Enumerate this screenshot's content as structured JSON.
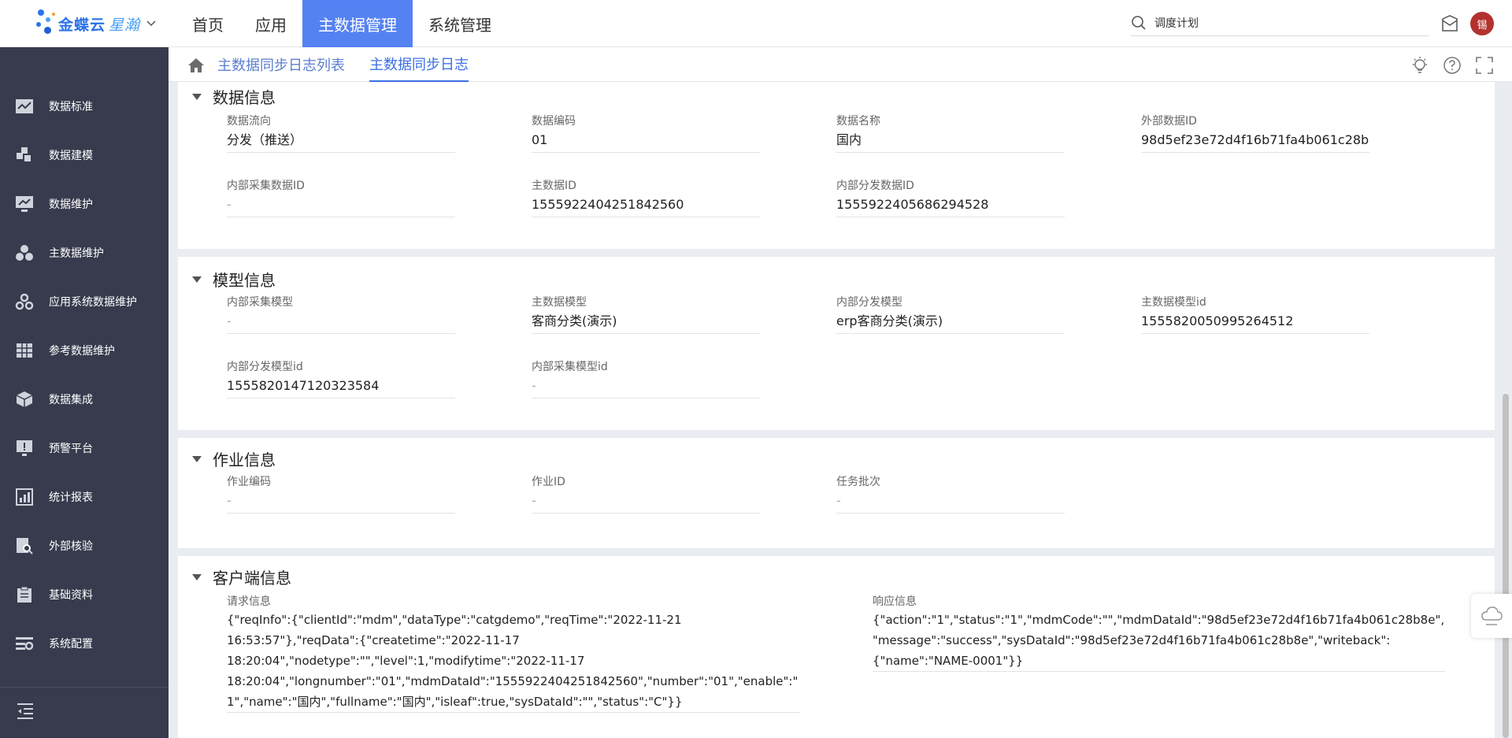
{
  "header": {
    "logo_text": "金蝶云",
    "logo_sub": "星瀚",
    "nav": [
      {
        "label": "首页"
      },
      {
        "label": "应用"
      },
      {
        "label": "主数据管理",
        "active": true
      },
      {
        "label": "系统管理"
      }
    ],
    "search_text": "调度计划",
    "avatar_text": "锡"
  },
  "sidebar": {
    "items": [
      {
        "label": "数据标准",
        "icon": "chart-board-icon"
      },
      {
        "label": "数据建模",
        "icon": "puzzle-icon"
      },
      {
        "label": "数据维护",
        "icon": "monitor-icon"
      },
      {
        "label": "主数据维护",
        "icon": "circles-icon"
      },
      {
        "label": "应用系统数据维护",
        "icon": "gears-icon"
      },
      {
        "label": "参考数据维护",
        "icon": "table-icon"
      },
      {
        "label": "数据集成",
        "icon": "cube-icon"
      },
      {
        "label": "预警平台",
        "icon": "alert-screen-icon"
      },
      {
        "label": "统计报表",
        "icon": "report-icon"
      },
      {
        "label": "外部核验",
        "icon": "search-doc-icon"
      },
      {
        "label": "基础资料",
        "icon": "clipboard-icon"
      },
      {
        "label": "系统配置",
        "icon": "settings-icon"
      }
    ]
  },
  "breadcrumb": {
    "items": [
      "主数据同步日志列表",
      "主数据同步日志"
    ]
  },
  "sections": {
    "data_info": {
      "title": "数据信息",
      "fields": [
        {
          "label": "数据流向",
          "value": "分发（推送）"
        },
        {
          "label": "数据编码",
          "value": "01"
        },
        {
          "label": "数据名称",
          "value": "国内"
        },
        {
          "label": "外部数据ID",
          "value": "98d5ef23e72d4f16b71fa4b061c28b8e"
        },
        {
          "label": "内部采集数据ID",
          "value": "-"
        },
        {
          "label": "主数据ID",
          "value": "1555922404251842560"
        },
        {
          "label": "内部分发数据ID",
          "value": "1555922405686294528"
        }
      ]
    },
    "model_info": {
      "title": "模型信息",
      "fields": [
        {
          "label": "内部采集模型",
          "value": "-"
        },
        {
          "label": "主数据模型",
          "value": "客商分类(演示)"
        },
        {
          "label": "内部分发模型",
          "value": "erp客商分类(演示)"
        },
        {
          "label": "主数据模型id",
          "value": "1555820050995264512"
        },
        {
          "label": "内部分发模型id",
          "value": "1555820147120323584"
        },
        {
          "label": "内部采集模型id",
          "value": "-"
        }
      ]
    },
    "job_info": {
      "title": "作业信息",
      "fields": [
        {
          "label": "作业编码",
          "value": "-"
        },
        {
          "label": "作业ID",
          "value": "-"
        },
        {
          "label": "任务批次",
          "value": "-"
        }
      ]
    },
    "client_info": {
      "title": "客户端信息",
      "request_label": "请求信息",
      "request_lines": [
        "{\"reqInfo\":{\"clientId\":\"mdm\",\"dataType\":\"catgdemo\",\"reqTime\":\"2022-11-21",
        "16:53:57\"},\"reqData\":{\"createtime\":\"2022-11-17",
        "18:20:04\",\"nodetype\":\"\",\"level\":1,\"modifytime\":\"2022-11-17",
        "18:20:04\",\"longnumber\":\"01\",\"mdmDataId\":\"1555922404251842560\",\"number\":\"01\",\"enable\":\"",
        "1\",\"name\":\"国内\",\"fullname\":\"国内\",\"isleaf\":true,\"sysDataId\":\"\",\"status\":\"C\"}}"
      ],
      "response_label": "响应信息",
      "response_lines": [
        "{\"action\":\"1\",\"status\":\"1\",\"mdmCode\":\"\",\"mdmDataId\":\"98d5ef23e72d4f16b71fa4b061c28b8e\",",
        "\"message\":\"success\",\"sysDataId\":\"98d5ef23e72d4f16b71fa4b061c28b8e\",\"writeback\":",
        "{\"name\":\"NAME-0001\"}}"
      ]
    }
  },
  "colors": {
    "accent": "#5582f3",
    "sidebar_bg": "#373b4d",
    "avatar_bg": "#b3322f"
  }
}
